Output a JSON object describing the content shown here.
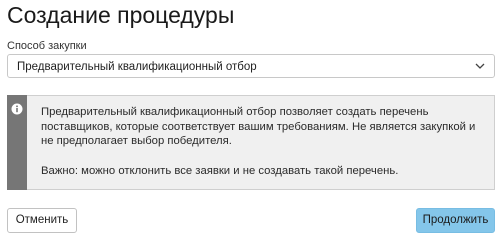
{
  "header": {
    "title": "Создание процедуры"
  },
  "form": {
    "method_label": "Способ закупки",
    "method_value": "Предварительный квалификационный отбор",
    "method_chevron_icon": "chevron-down-icon"
  },
  "info": {
    "icon": "info-icon",
    "text_1": "Предварительный квалификационный отбор позволяет создать перечень поставщиков, которые соответствует вашим требованиям. Не является закупкой и не предполагает выбор победителя.",
    "text_2": "Важно: можно отклонить все заявки и не создавать такой перечень."
  },
  "actions": {
    "cancel_label": "Отменить",
    "continue_label": "Продолжить"
  },
  "colors": {
    "primary_button": "#84c6ea",
    "info_strip": "#767676",
    "info_background": "#f0f0f0"
  }
}
